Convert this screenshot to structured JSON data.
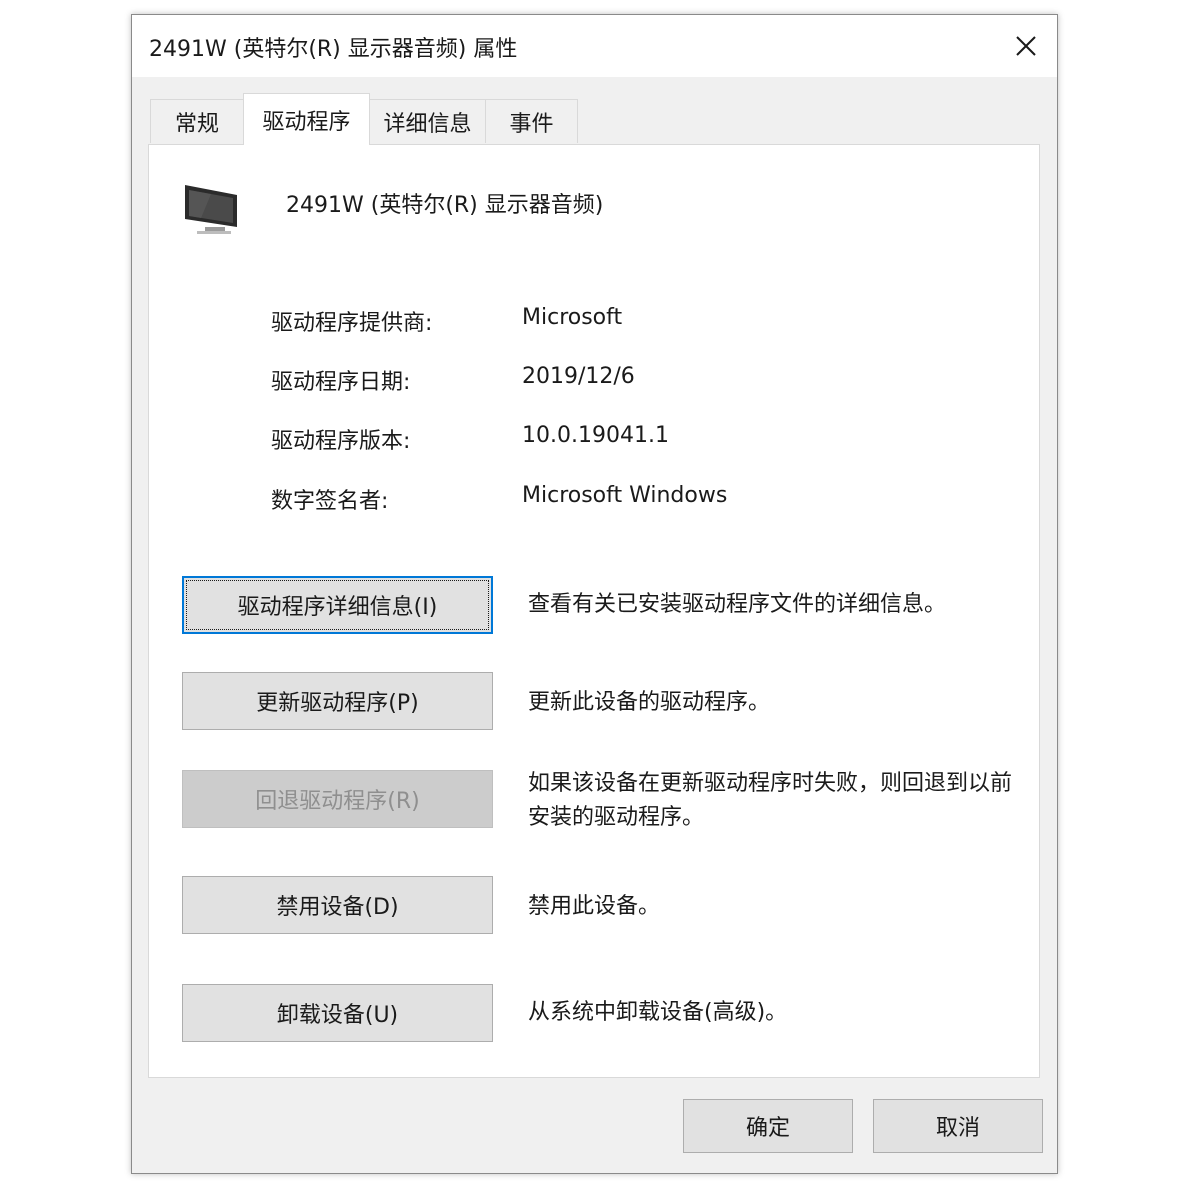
{
  "window": {
    "title": "2491W (英特尔(R) 显示器音频) 属性",
    "close_icon": "close-icon"
  },
  "tabs": [
    {
      "label": "常规",
      "active": false
    },
    {
      "label": "驱动程序",
      "active": true
    },
    {
      "label": "详细信息",
      "active": false
    },
    {
      "label": "事件",
      "active": false
    }
  ],
  "device": {
    "icon": "monitor-icon",
    "name": "2491W (英特尔(R) 显示器音频)"
  },
  "info": [
    {
      "label": "驱动程序提供商:",
      "value": "Microsoft"
    },
    {
      "label": "驱动程序日期:",
      "value": "2019/12/6"
    },
    {
      "label": "驱动程序版本:",
      "value": "10.0.19041.1"
    },
    {
      "label": "数字签名者:",
      "value": "Microsoft Windows"
    }
  ],
  "actions": [
    {
      "label": "驱动程序详细信息(I)",
      "description": "查看有关已安装驱动程序文件的详细信息。",
      "enabled": true,
      "focused": true
    },
    {
      "label": "更新驱动程序(P)",
      "description": "更新此设备的驱动程序。",
      "enabled": true,
      "focused": false
    },
    {
      "label": "回退驱动程序(R)",
      "description": "如果该设备在更新驱动程序时失败，则回退到以前安装的驱动程序。",
      "enabled": false,
      "focused": false
    },
    {
      "label": "禁用设备(D)",
      "description": "禁用此设备。",
      "enabled": true,
      "focused": false
    },
    {
      "label": "卸载设备(U)",
      "description": "从系统中卸载设备(高级)。",
      "enabled": true,
      "focused": false
    }
  ],
  "footer": {
    "ok_label": "确定",
    "cancel_label": "取消"
  },
  "colors": {
    "focus_border": "#0078d7",
    "button_bg": "#e1e1e1",
    "disabled_text": "#8f8f8f"
  }
}
